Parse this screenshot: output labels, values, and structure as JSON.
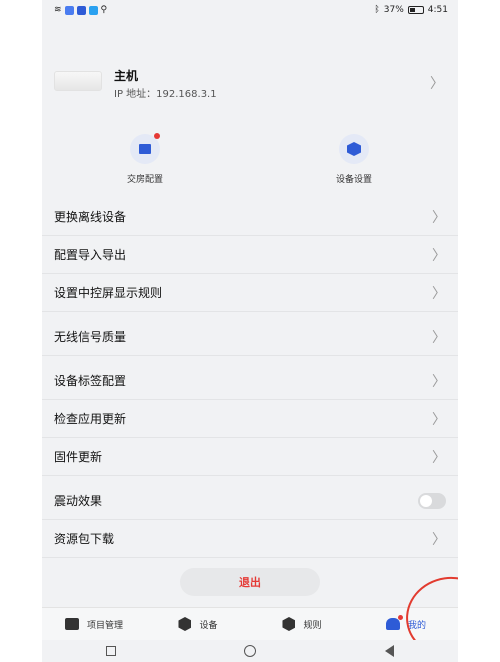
{
  "status_bar": {
    "battery_text": "37%",
    "time": "4:51"
  },
  "device": {
    "name": "主机",
    "ip_label": "IP 地址：192.168.3.1"
  },
  "quick_actions": [
    {
      "label": "交房配置",
      "icon": "building-icon",
      "badge": true
    },
    {
      "label": "设备设置",
      "icon": "hexagon-settings-icon",
      "badge": false
    }
  ],
  "menu": {
    "group1": [
      {
        "label": "更换离线设备"
      },
      {
        "label": "配置导入导出"
      },
      {
        "label": "设置中控屏显示规则"
      }
    ],
    "group2": [
      {
        "label": "无线信号质量"
      }
    ],
    "group3": [
      {
        "label": "设备标签配置"
      },
      {
        "label": "检查应用更新"
      },
      {
        "label": "固件更新"
      }
    ],
    "group4": [
      {
        "label": "震动效果",
        "toggle": false
      },
      {
        "label": "资源包下载"
      }
    ]
  },
  "logout_label": "退出",
  "tabs": [
    {
      "label": "项目管理",
      "icon": "folder-icon",
      "active": false
    },
    {
      "label": "设备",
      "icon": "hexagon-icon",
      "active": false
    },
    {
      "label": "规则",
      "icon": "cube-icon",
      "active": false
    },
    {
      "label": "我的",
      "icon": "person-icon",
      "active": true
    }
  ],
  "colors": {
    "accent": "#2e5bd6",
    "danger": "#e53935",
    "background": "#f1f2f4"
  }
}
